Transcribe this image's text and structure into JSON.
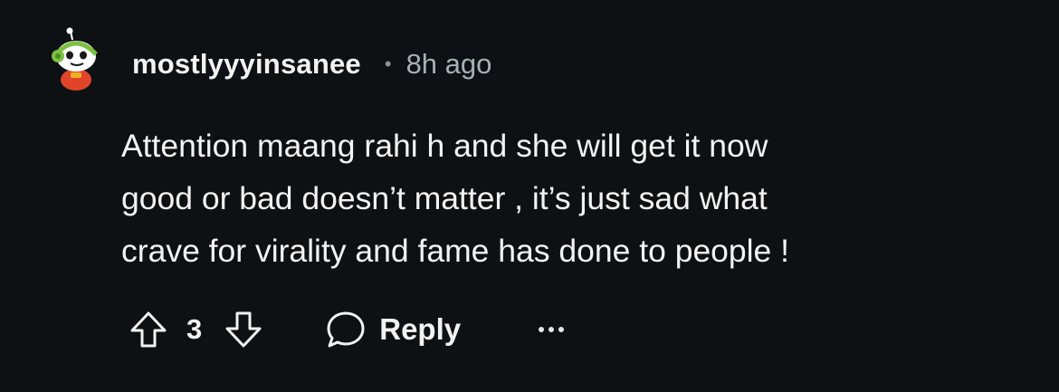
{
  "comment": {
    "username": "mostlyyyinsanee",
    "separator": "•",
    "timestamp": "8h ago",
    "body_lines": [
      "Attention maang rahi h and she will get it now",
      "good or bad doesn’t matter , it’s just sad what",
      "crave for virality and fame has done to people !"
    ],
    "vote_count": "3",
    "reply_label": "Reply",
    "icons": {
      "avatar": "snoo-avatar",
      "upvote": "upvote-arrow-icon",
      "downvote": "downvote-arrow-icon",
      "reply": "speech-bubble-icon",
      "more": "more-dots-icon"
    }
  },
  "colors": {
    "background": "#0e1113",
    "text": "#f2f2f2",
    "muted": "#a7b0b5"
  }
}
